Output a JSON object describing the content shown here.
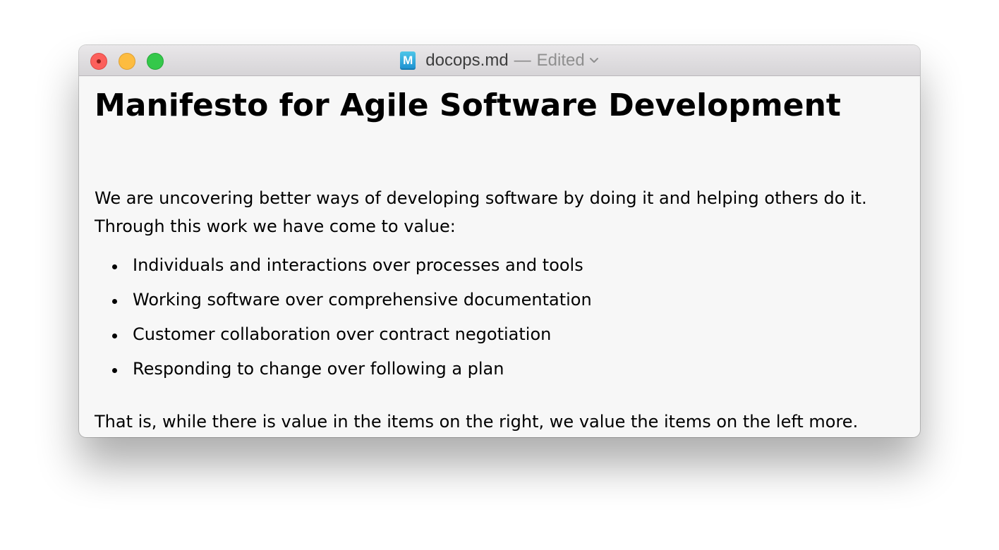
{
  "window": {
    "filename": "docops.md",
    "separator": "—",
    "status": "Edited",
    "file_icon_letter": "M",
    "icons": {
      "close": "close-traffic-light-icon",
      "minimize": "minimize-traffic-light-icon",
      "zoom": "zoom-traffic-light-icon",
      "file": "markdown-file-icon",
      "chevron": "chevron-down-icon"
    },
    "colors": {
      "close": "#fc605c",
      "minimize": "#fdbc40",
      "zoom": "#34c84a",
      "file_icon": "#1b8fd0"
    }
  },
  "document": {
    "heading": "Manifesto for Agile Software Development",
    "intro": "We are uncovering better ways of developing software by doing it and helping others do it. Through this work we have come to value:",
    "values": [
      "Individuals and interactions over processes and tools",
      "Working software over comprehensive documentation",
      "Customer collaboration over contract negotiation",
      "Responding to change over following a plan"
    ],
    "conclusion": "That is, while there is value in the items on the right, we value the items on the left more."
  }
}
